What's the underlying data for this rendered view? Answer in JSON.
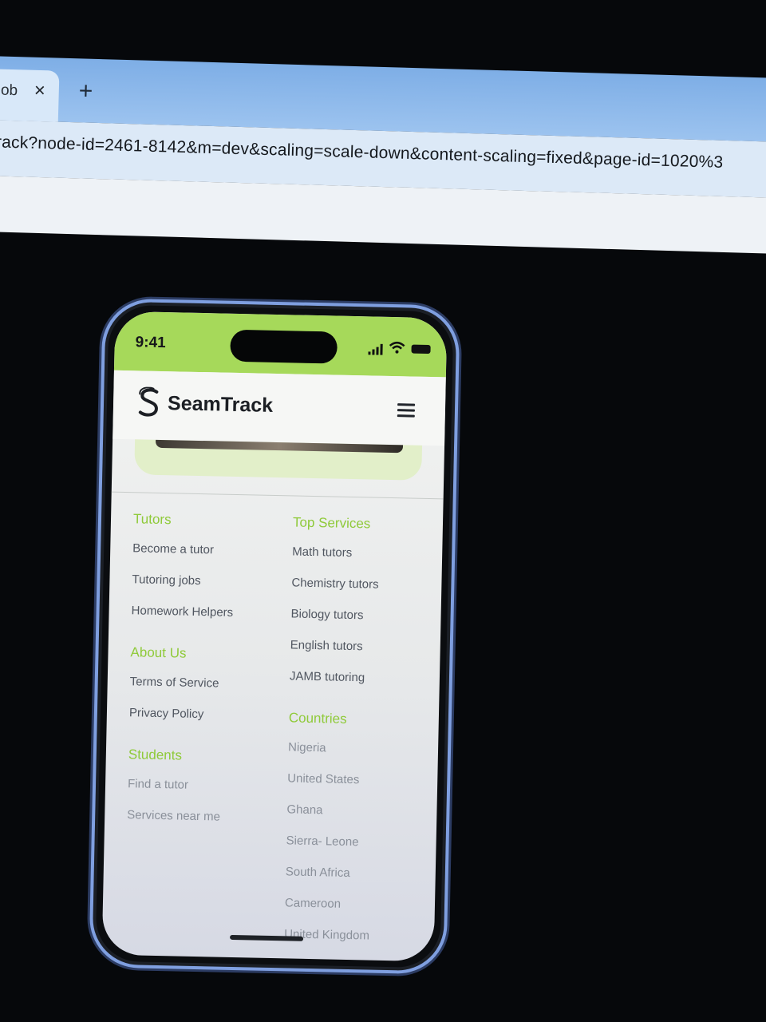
{
  "browser": {
    "tab_title": "lob",
    "tab_close": "×",
    "new_tab": "+",
    "url": "rack?node-id=2461-8142&m=dev&scaling=scale-down&content-scaling=fixed&page-id=1020%3"
  },
  "status": {
    "time": "9:41"
  },
  "app": {
    "brand": "SeamTrack",
    "accent_color": "#a6d95a"
  },
  "footer": {
    "tutors": {
      "title": "Tutors",
      "links": [
        "Become a tutor",
        "Tutoring jobs",
        "Homework Helpers"
      ]
    },
    "about": {
      "title": "About Us",
      "links": [
        "Terms of Service",
        "Privacy Policy"
      ]
    },
    "students": {
      "title": "Students",
      "links": [
        "Find a tutor",
        "Services near me"
      ]
    },
    "top_services": {
      "title": "Top Services",
      "links": [
        "Math tutors",
        "Chemistry tutors",
        "Biology tutors",
        "English tutors",
        "JAMB tutoring"
      ]
    },
    "countries": {
      "title": "Countries",
      "links": [
        "Nigeria",
        "United States",
        "Ghana",
        "Sierra- Leone",
        "South Africa",
        "Cameroon",
        "United Kingdom"
      ]
    }
  }
}
